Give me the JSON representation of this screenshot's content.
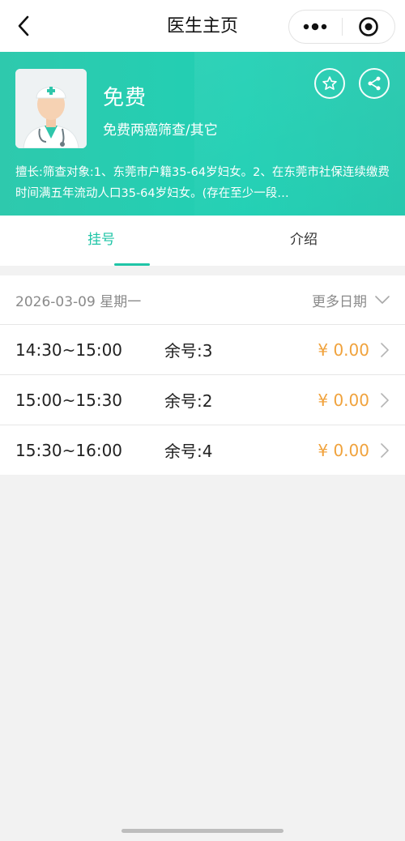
{
  "nav": {
    "title": "医生主页",
    "back_icon": "chevron-left-icon",
    "more_icon": "more-dots-icon",
    "close_icon": "target-circle-icon"
  },
  "doctor": {
    "name": "免费",
    "title": "免费两癌筛查/其它",
    "specialty": "擅长:筛查对象:1、东莞市户籍35-64岁妇女。2、在东莞市社保连续缴费时间满五年流动人口35-64岁妇女。(存在至少一段…",
    "avatar_icon": "doctor-avatar-icon",
    "favorite_icon": "star-icon",
    "share_icon": "share-icon"
  },
  "tabs": [
    {
      "label": "挂号",
      "active": true
    },
    {
      "label": "介绍",
      "active": false
    }
  ],
  "schedule": {
    "date": "2026-03-09 星期一",
    "more_dates_label": "更多日期",
    "slots": [
      {
        "time": "14:30~15:00",
        "remaining": "余号:3",
        "price": "¥ 0.00"
      },
      {
        "time": "15:00~15:30",
        "remaining": "余号:2",
        "price": "¥ 0.00"
      },
      {
        "time": "15:30~16:00",
        "remaining": "余号:4",
        "price": "¥ 0.00"
      }
    ]
  },
  "colors": {
    "accent": "#1fc5a7",
    "header_bg": "#2ec9ad",
    "price": "#f0a23c",
    "muted_text": "#8a8a8a"
  }
}
